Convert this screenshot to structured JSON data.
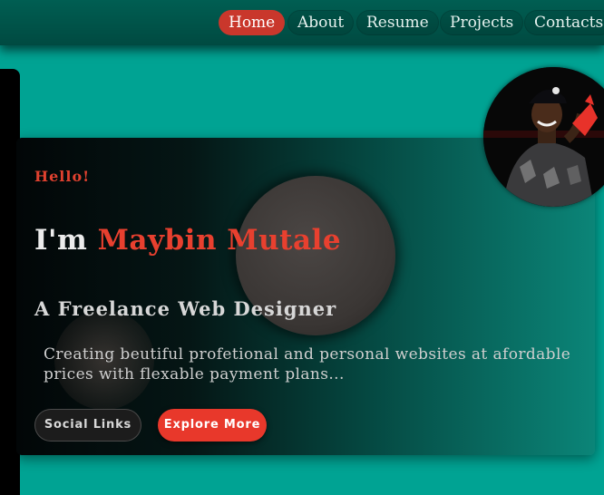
{
  "nav": {
    "items": [
      {
        "label": "Home",
        "active": true
      },
      {
        "label": "About",
        "active": false
      },
      {
        "label": "Resume",
        "active": false
      },
      {
        "label": "Projects",
        "active": false
      },
      {
        "label": "Contacts",
        "active": false
      }
    ]
  },
  "hero": {
    "greeting": "Hello!",
    "intro_prefix": "I'm ",
    "name": "Maybin Mutale",
    "subtitle": "A Freelance Web Designer",
    "description": "Creating beutiful profetional and personal websites at afordable prices with flexable payment plans...",
    "buttons": {
      "social": "Social Links",
      "explore": "Explore More"
    }
  },
  "colors": {
    "background": "#00a393",
    "accent": "#e8402f",
    "nav_bar": "#005e52"
  },
  "avatar": {
    "icon": "profile-photo"
  }
}
